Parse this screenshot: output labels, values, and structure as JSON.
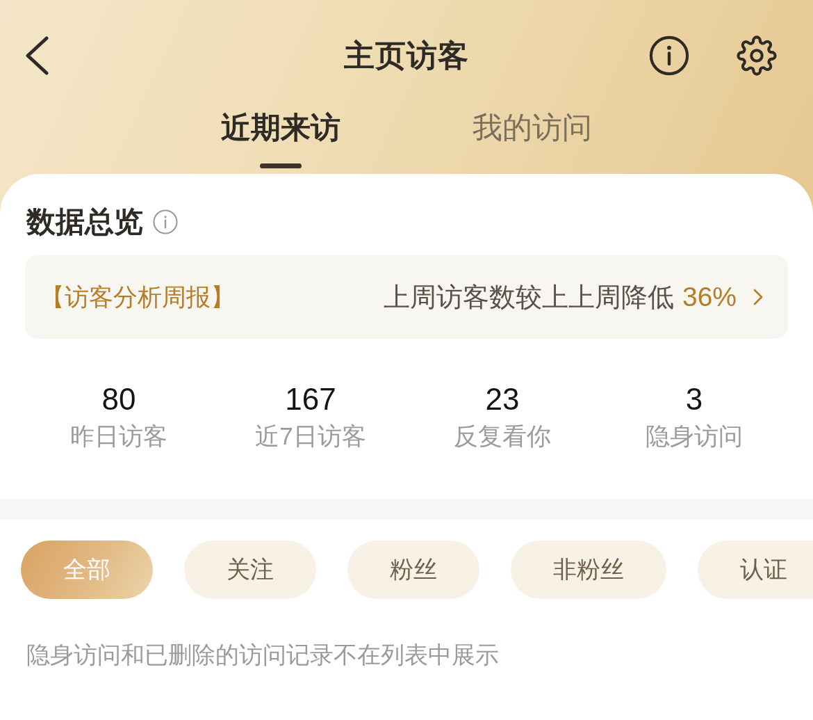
{
  "header": {
    "title": "主页访客"
  },
  "tabs": [
    {
      "label": "近期来访",
      "selected": true
    },
    {
      "label": "我的访问",
      "selected": false
    }
  ],
  "overview": {
    "title": "数据总览",
    "report": {
      "tag": "【访客分析周报】",
      "summary": "上周访客数较上上周降低",
      "change": "36%"
    }
  },
  "stats": [
    {
      "value": "80",
      "label": "昨日访客"
    },
    {
      "value": "167",
      "label": "近7日访客"
    },
    {
      "value": "23",
      "label": "反复看你"
    },
    {
      "value": "3",
      "label": "隐身访问"
    }
  ],
  "filters": [
    {
      "label": "全部",
      "selected": true
    },
    {
      "label": "关注",
      "selected": false
    },
    {
      "label": "粉丝",
      "selected": false
    },
    {
      "label": "非粉丝",
      "selected": false
    },
    {
      "label": "认证",
      "selected": false
    }
  ],
  "note": "隐身访问和已删除的访问记录不在列表中展示"
}
